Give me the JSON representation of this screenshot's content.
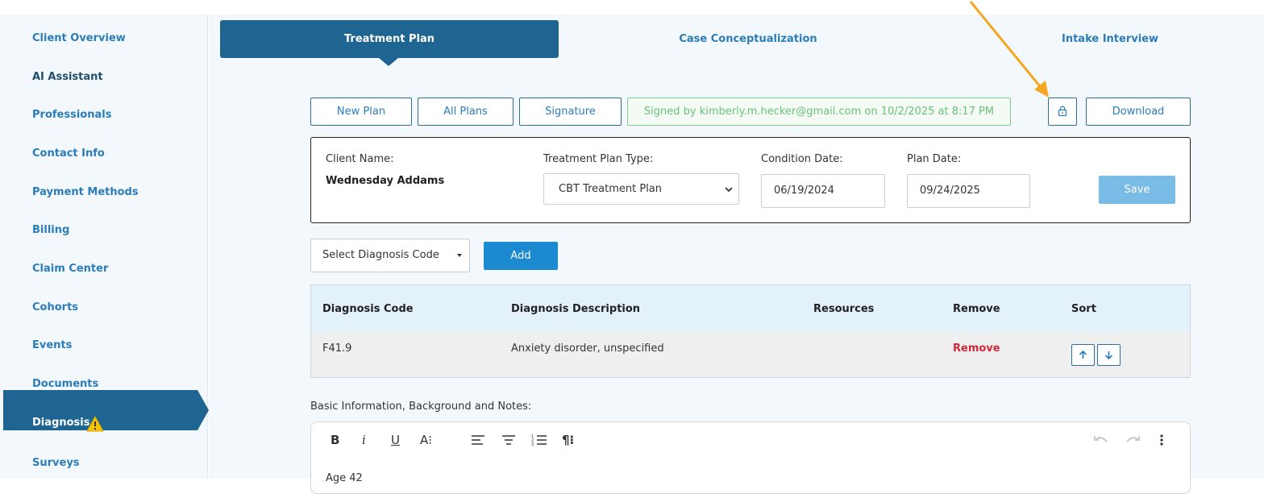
{
  "sidebar": {
    "items": [
      {
        "label": "Client Overview"
      },
      {
        "label": "AI Assistant"
      },
      {
        "label": "Professionals"
      },
      {
        "label": "Contact Info"
      },
      {
        "label": "Payment Methods"
      },
      {
        "label": "Billing"
      },
      {
        "label": "Claim Center"
      },
      {
        "label": "Cohorts"
      },
      {
        "label": "Events"
      },
      {
        "label": "Documents"
      },
      {
        "label": "Diagnosis",
        "active": true,
        "icon": "warning-icon"
      },
      {
        "label": "Surveys"
      }
    ]
  },
  "tabs": [
    {
      "label": "Treatment Plan",
      "active": true
    },
    {
      "label": "Case Conceptualization"
    },
    {
      "label": "Intake Interview"
    }
  ],
  "toolbar": {
    "new_plan": "New Plan",
    "all_plans": "All Plans",
    "signature": "Signature",
    "signed_text": "Signed by kimberly.m.hecker@gmail.com on 10/2/2025 at 8:17 PM",
    "lock_icon": "lock-icon",
    "download": "Download"
  },
  "plan": {
    "client_name_label": "Client Name:",
    "client_name": "Wednesday Addams",
    "type_label": "Treatment Plan Type:",
    "type_value": "CBT Treatment Plan",
    "condition_date_label": "Condition Date:",
    "condition_date": "06/19/2024",
    "plan_date_label": "Plan Date:",
    "plan_date": "09/24/2025",
    "save": "Save"
  },
  "diagnosis": {
    "select_placeholder": "Select Diagnosis Code",
    "add": "Add",
    "headers": [
      "Diagnosis Code",
      "Diagnosis Description",
      "Resources",
      "Remove",
      "Sort"
    ],
    "rows": [
      {
        "code": "F41.9",
        "description": "Anxiety disorder, unspecified",
        "resources": "",
        "remove": "Remove"
      }
    ]
  },
  "notes": {
    "label": "Basic Information, Background and Notes:",
    "toolbar": {
      "bold": "B",
      "italic": "i",
      "underline": "U",
      "font_size": "A⁝",
      "paragraph": "¶⁝"
    },
    "content_preview": "Age 42"
  },
  "colors": {
    "primary": "#1e6591",
    "link": "#2b7cb9",
    "signed_green": "#6cc07a",
    "remove_red": "#d0283a",
    "annotation_arrow": "#f5a623"
  }
}
